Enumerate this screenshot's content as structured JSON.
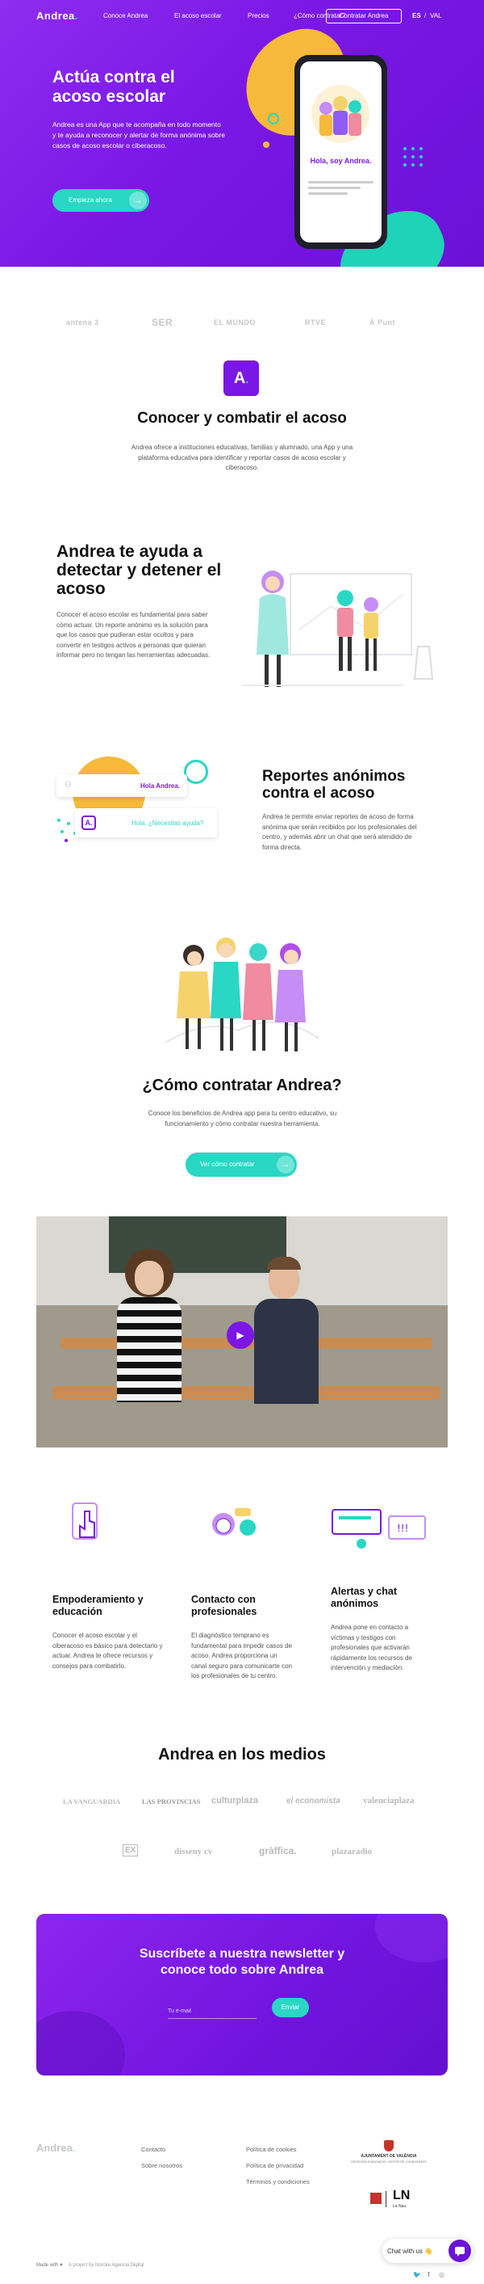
{
  "nav": {
    "logo": "Andrea",
    "links": [
      "Conoce Andrea",
      "El acoso escolar",
      "Precios",
      "¿Cómo contratar?"
    ],
    "cta": "Contratar Andrea",
    "lang_es": "ES",
    "lang_sep": "/",
    "lang_val": "VAL"
  },
  "hero": {
    "title": "Actúa contra el acoso escolar",
    "text": "Andrea es una App que te acompaña en todo momento y te ayuda a reconocer y alertar de forma anónima sobre casos de acoso escolar o ciberacoso.",
    "cta": "Empieza ahora",
    "phone_greeting": "Hola, soy Andrea."
  },
  "partners": [
    "antena 3",
    "SER",
    "EL MUNDO",
    "RTVE",
    "À Punt"
  ],
  "intro": {
    "badge": "A",
    "title": "Conocer y combatir el acoso",
    "text": "Andrea ofrece a instituciones educativas, familias y alumnado, una App y una plataforma educativa para identificar y reportar casos de acoso escolar y ciberacoso."
  },
  "section_detect": {
    "title": "Andrea te ayuda a detectar y detener el acoso",
    "text": "Conocer el acoso escolar es fundamental para saber cómo actuar. Un reporte anónimo es la solución para que los casos que pudieran estar ocultos y para convertir en testigos activos a personas que quieran informar pero no tengan las herramientas adecuadas."
  },
  "section_reports": {
    "bubble1": "Hola Andrea.",
    "bubble2": "Hola. ¿Necesitas ayuda?",
    "title": "Reportes anónimos contra el acoso",
    "text": "Andrea te permite enviar reportes de acoso de forma anónima que serán recibidos por los profesionales del centro, y además abrir un chat que será atendido de forma directa."
  },
  "section_hire": {
    "title": "¿Cómo contratar Andrea?",
    "text": "Conoce los beneficios de Andrea app para tu centro educativo, su funcionamiento y cómo contratar nuestra herramienta.",
    "cta": "Ver cómo contratar"
  },
  "features": [
    {
      "title": "Empoderamiento y educación",
      "text": "Conocer el acoso escolar y el ciberacoso es básico para detectarlo y actuar. Andrea te ofrece recursos y consejos para combatirlo."
    },
    {
      "title": "Contacto con profesionales",
      "text": "El diagnóstico temprano es fundamental para impedir casos de acoso. Andrea proporciona un canal seguro para comunicarte con los profesionales de tu centro."
    },
    {
      "title": "Alertas y chat anónimos",
      "text": "Andrea pone en contacto a víctimas y testigos con profesionales que activarán rápidamente los recursos de intervención y mediación."
    }
  ],
  "media": {
    "title": "Andrea en los medios",
    "row1": [
      "LA VANGUARDIA",
      "LAS PROVINCIAS",
      "culturplaza",
      "el economista",
      "valenciaplaza"
    ],
    "row2": [
      "EX",
      "disseny cv",
      "gràffica.",
      "plazaradio"
    ]
  },
  "newsletter": {
    "title": "Suscríbete a nuestra newsletter y conoce todo sobre Andrea",
    "placeholder": "Tu e-mail",
    "button": "Enviar"
  },
  "footer": {
    "logo": "Andrea",
    "col1": [
      "Contacto",
      "Sobre nosotros"
    ],
    "col2": [
      "Política de cookies",
      "Política de privacidad",
      "Términos y condiciones"
    ],
    "ajuntament": "AJUNTAMENT DE VALÈNCIA",
    "ajuntament_sub": "REGIDORIA D'INNOVACIÓ I GESTIÓ DEL CONEIXEMENT",
    "lanau_line1": "LN",
    "lanau_line2": "La Nau",
    "made_with": "Made with ♥",
    "project": "A project by Norcke Agencia Digital",
    "chat": "Chat with us 👋",
    "social": [
      "twitter-icon",
      "facebook-icon",
      "instagram-icon"
    ]
  },
  "colors": {
    "purple": "#7a17e4",
    "teal": "#2ad6c4",
    "yellow": "#f6b93a"
  }
}
